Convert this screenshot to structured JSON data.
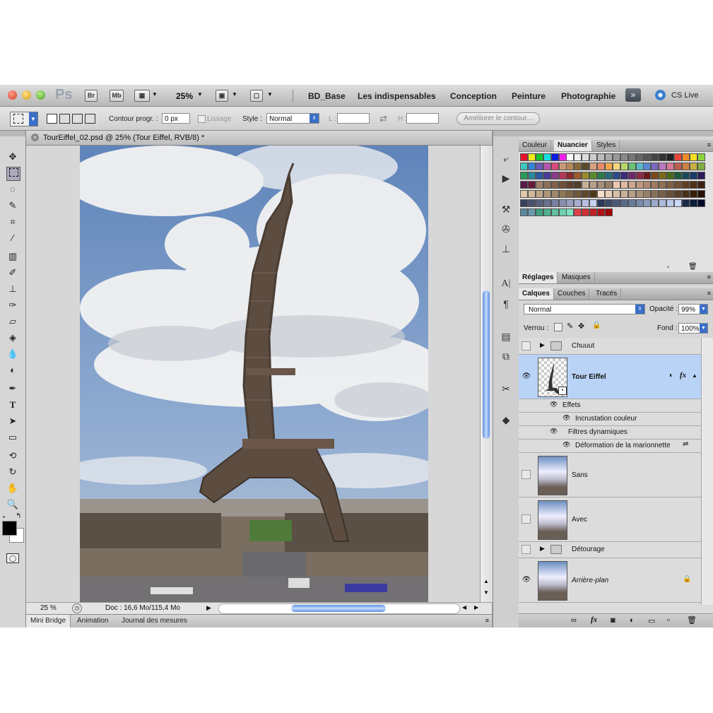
{
  "appbar": {
    "logo": "Ps",
    "br": "Br",
    "mb": "Mb",
    "zoom": "25%",
    "workspaces": [
      "BD_Base",
      "Les indispensables",
      "Conception",
      "Peinture",
      "Photographie"
    ],
    "cslive": "CS Live"
  },
  "options": {
    "contour_label": "Contour progr. :",
    "contour_value": "0 px",
    "lissage": "Lissage",
    "style_label": "Style :",
    "style_value": "Normal",
    "l_label": "L :",
    "h_label": "H :",
    "ameliorer": "Améliorer le contour..."
  },
  "document": {
    "tab_title": "TourEiffel_02.psd @ 25% (Tour Eiffel, RVB/8) *",
    "zoom": "25 %",
    "doc_info": "Doc : 16,6 Mo/115,4 Mo"
  },
  "bottom_tabs": [
    "Mini Bridge",
    "Animation",
    "Journal des mesures"
  ],
  "panels": {
    "color_tabs": [
      "Couleur",
      "Nuancier",
      "Styles"
    ],
    "adjust_tabs": [
      "Réglages",
      "Masques"
    ],
    "layer_tabs": [
      "Calques",
      "Couches",
      "Tracés"
    ],
    "blend_mode": "Normal",
    "opacity_label": "Opacité :",
    "opacity": "99%",
    "lock_label": "Verrou :",
    "fill_label": "Fond :",
    "fill": "100%"
  },
  "layers": {
    "chuuut": "Chuuut",
    "tour": "Tour Eiffel",
    "effets": "Effets",
    "incrustation": "Incrustation couleur",
    "filtres": "Filtres dynamiques",
    "deformation": "Déformation de la marionnette",
    "sans": "Sans",
    "avec": "Avec",
    "detourage": "Détourage",
    "arriere": "Arrière-plan"
  },
  "colors": {
    "selected_layer": "#b9d3f7",
    "foreground": "#000000",
    "background": "#ffffff"
  }
}
